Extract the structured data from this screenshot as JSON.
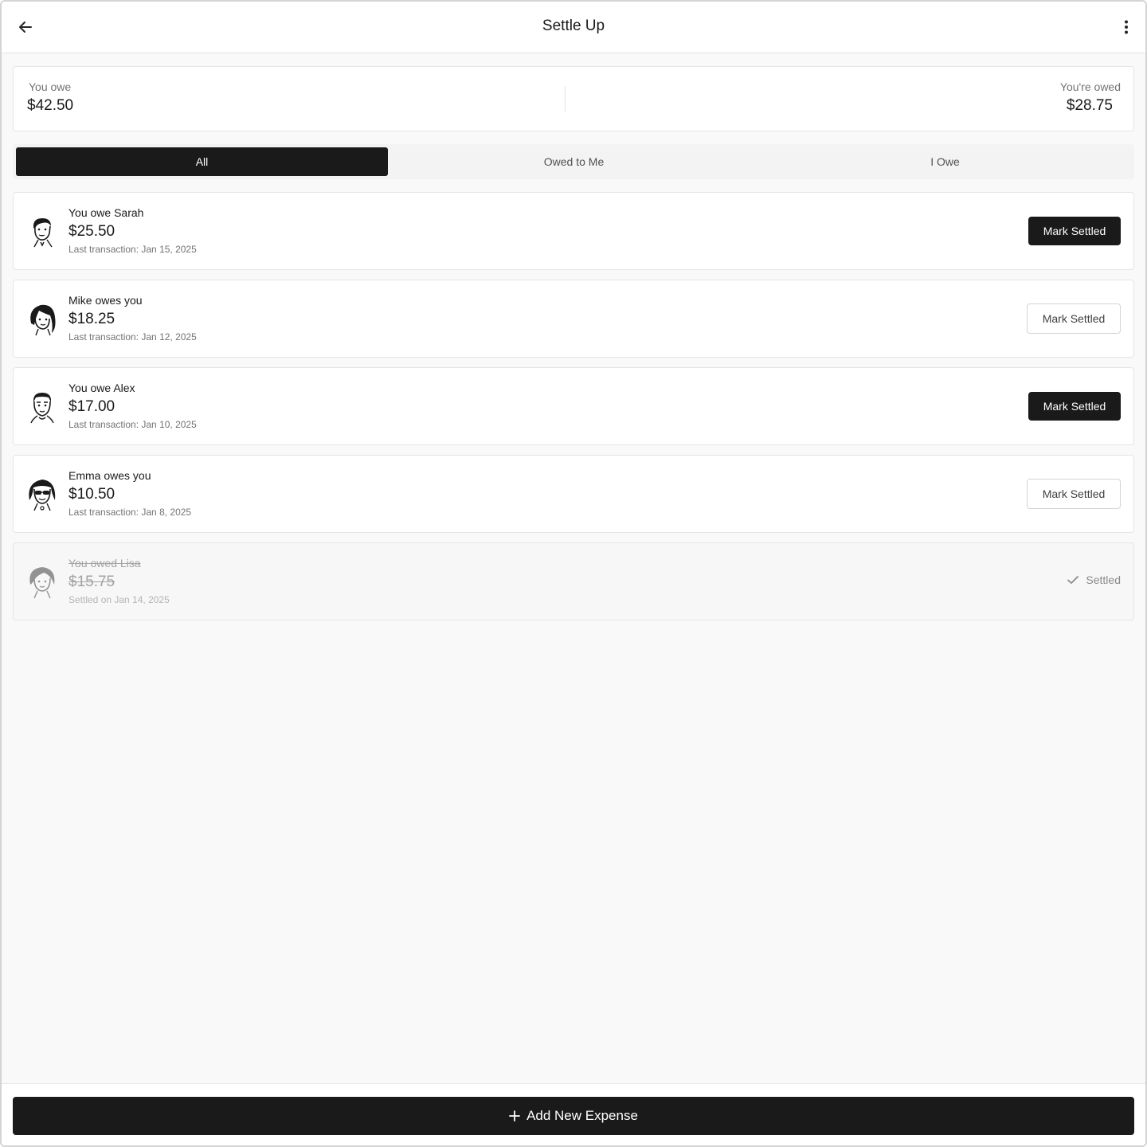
{
  "header": {
    "title": "Settle Up",
    "back_icon": "arrow-left-icon",
    "menu_icon": "more-vertical-icon"
  },
  "summary": {
    "you_owe_label": "You owe",
    "you_owe_value": "$42.50",
    "youre_owed_label": "You're owed",
    "youre_owed_value": "$28.75"
  },
  "tabs": [
    {
      "label": "All",
      "active": true
    },
    {
      "label": "Owed to Me",
      "active": false
    },
    {
      "label": "I Owe",
      "active": false
    }
  ],
  "balances": [
    {
      "title": "You owe Sarah",
      "amount": "$25.50",
      "date": "Last transaction: Jan 15, 2025",
      "action": "Mark Settled",
      "style": "dark"
    },
    {
      "title": "Mike owes you",
      "amount": "$18.25",
      "date": "Last transaction: Jan 12, 2025",
      "action": "Mark Settled",
      "style": "light"
    },
    {
      "title": "You owe Alex",
      "amount": "$17.00",
      "date": "Last transaction: Jan 10, 2025",
      "action": "Mark Settled",
      "style": "dark"
    },
    {
      "title": "Emma owes you",
      "amount": "$10.50",
      "date": "Last transaction: Jan 8, 2025",
      "action": "Mark Settled",
      "style": "light"
    },
    {
      "title": "You owed Lisa",
      "amount": "$15.75",
      "date": "Settled on Jan 14, 2025",
      "status": "Settled",
      "status_icon": "check-icon"
    }
  ],
  "footer": {
    "add_label": "Add New Expense",
    "add_icon": "plus-icon"
  },
  "colors": {
    "primary": "#1a1a1a",
    "background": "#f9f9f9",
    "border": "#e5e5e5",
    "muted": "#737373"
  }
}
